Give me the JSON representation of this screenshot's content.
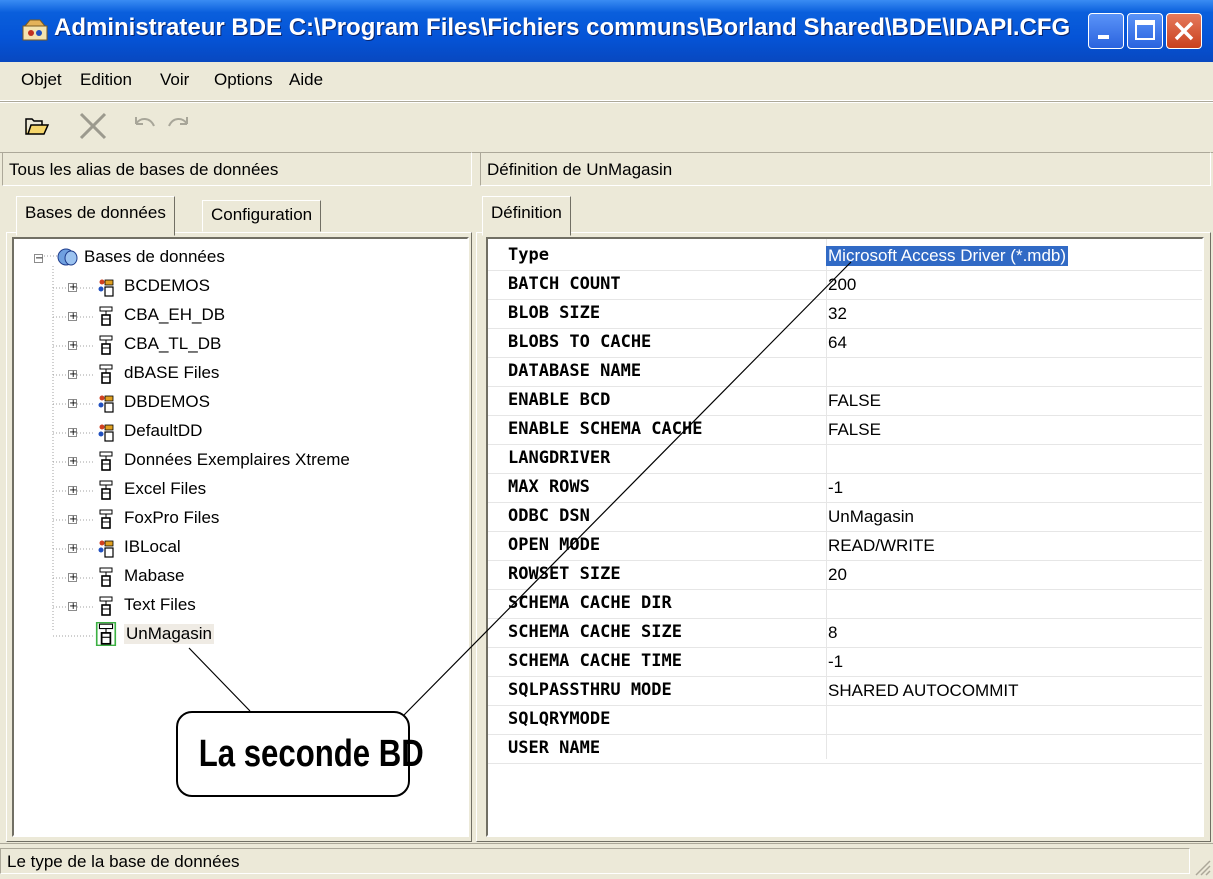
{
  "window": {
    "title": "Administrateur BDE  C:\\Program Files\\Fichiers communs\\Borland Shared\\BDE\\IDAPI.CFG",
    "controls": [
      "minimize-icon",
      "maximize-icon",
      "close-icon"
    ]
  },
  "menu": [
    "Objet",
    "Edition",
    "Voir",
    "Options",
    "Aide"
  ],
  "toolbar": {
    "icons": [
      "open-folder-icon",
      "delete-icon",
      "undo-icon",
      "redo-icon"
    ]
  },
  "left_header": "Tous les alias de bases de données",
  "right_header": "Définition de UnMagasin",
  "left_tabs": [
    "Bases de données",
    "Configuration"
  ],
  "right_tabs": [
    "Définition"
  ],
  "tree": {
    "root": "Bases de données",
    "items": [
      {
        "label": "BCDEMOS",
        "icon": "sql-db-icon"
      },
      {
        "label": "CBA_EH_DB",
        "icon": "odbc-db-icon"
      },
      {
        "label": "CBA_TL_DB",
        "icon": "odbc-db-icon"
      },
      {
        "label": "dBASE Files",
        "icon": "odbc-db-icon"
      },
      {
        "label": "DBDEMOS",
        "icon": "sql-db-icon"
      },
      {
        "label": "DefaultDD",
        "icon": "sql-db-icon"
      },
      {
        "label": "Données Exemplaires Xtreme",
        "icon": "odbc-db-icon"
      },
      {
        "label": "Excel Files",
        "icon": "odbc-db-icon"
      },
      {
        "label": "FoxPro Files",
        "icon": "odbc-db-icon"
      },
      {
        "label": "IBLocal",
        "icon": "sql-db-icon"
      },
      {
        "label": "Mabase",
        "icon": "odbc-db-icon"
      },
      {
        "label": "Text Files",
        "icon": "odbc-db-icon"
      },
      {
        "label": "UnMagasin",
        "icon": "odbc-db-icon"
      }
    ]
  },
  "properties": [
    {
      "key": "Type",
      "value": "Microsoft Access Driver (*.mdb)"
    },
    {
      "key": "BATCH COUNT",
      "value": "200"
    },
    {
      "key": "BLOB SIZE",
      "value": "32"
    },
    {
      "key": "BLOBS TO CACHE",
      "value": "64"
    },
    {
      "key": "DATABASE NAME",
      "value": ""
    },
    {
      "key": "ENABLE BCD",
      "value": "FALSE"
    },
    {
      "key": "ENABLE SCHEMA CACHE",
      "value": "FALSE"
    },
    {
      "key": "LANGDRIVER",
      "value": ""
    },
    {
      "key": "MAX ROWS",
      "value": "-1"
    },
    {
      "key": "ODBC DSN",
      "value": "UnMagasin"
    },
    {
      "key": "OPEN MODE",
      "value": "READ/WRITE"
    },
    {
      "key": "ROWSET SIZE",
      "value": "20"
    },
    {
      "key": "SCHEMA CACHE DIR",
      "value": ""
    },
    {
      "key": "SCHEMA CACHE SIZE",
      "value": "8"
    },
    {
      "key": "SCHEMA CACHE TIME",
      "value": "-1"
    },
    {
      "key": "SQLPASSTHRU MODE",
      "value": "SHARED AUTOCOMMIT"
    },
    {
      "key": "SQLQRYMODE",
      "value": ""
    },
    {
      "key": "USER NAME",
      "value": ""
    }
  ],
  "callout": "La seconde BD",
  "status": "Le type de la base de données",
  "colors": {
    "titlebar": "#0554D7",
    "selection": "#316AC5",
    "window_bg": "#ECE9D8",
    "selected_node_border": "#3CB043"
  }
}
